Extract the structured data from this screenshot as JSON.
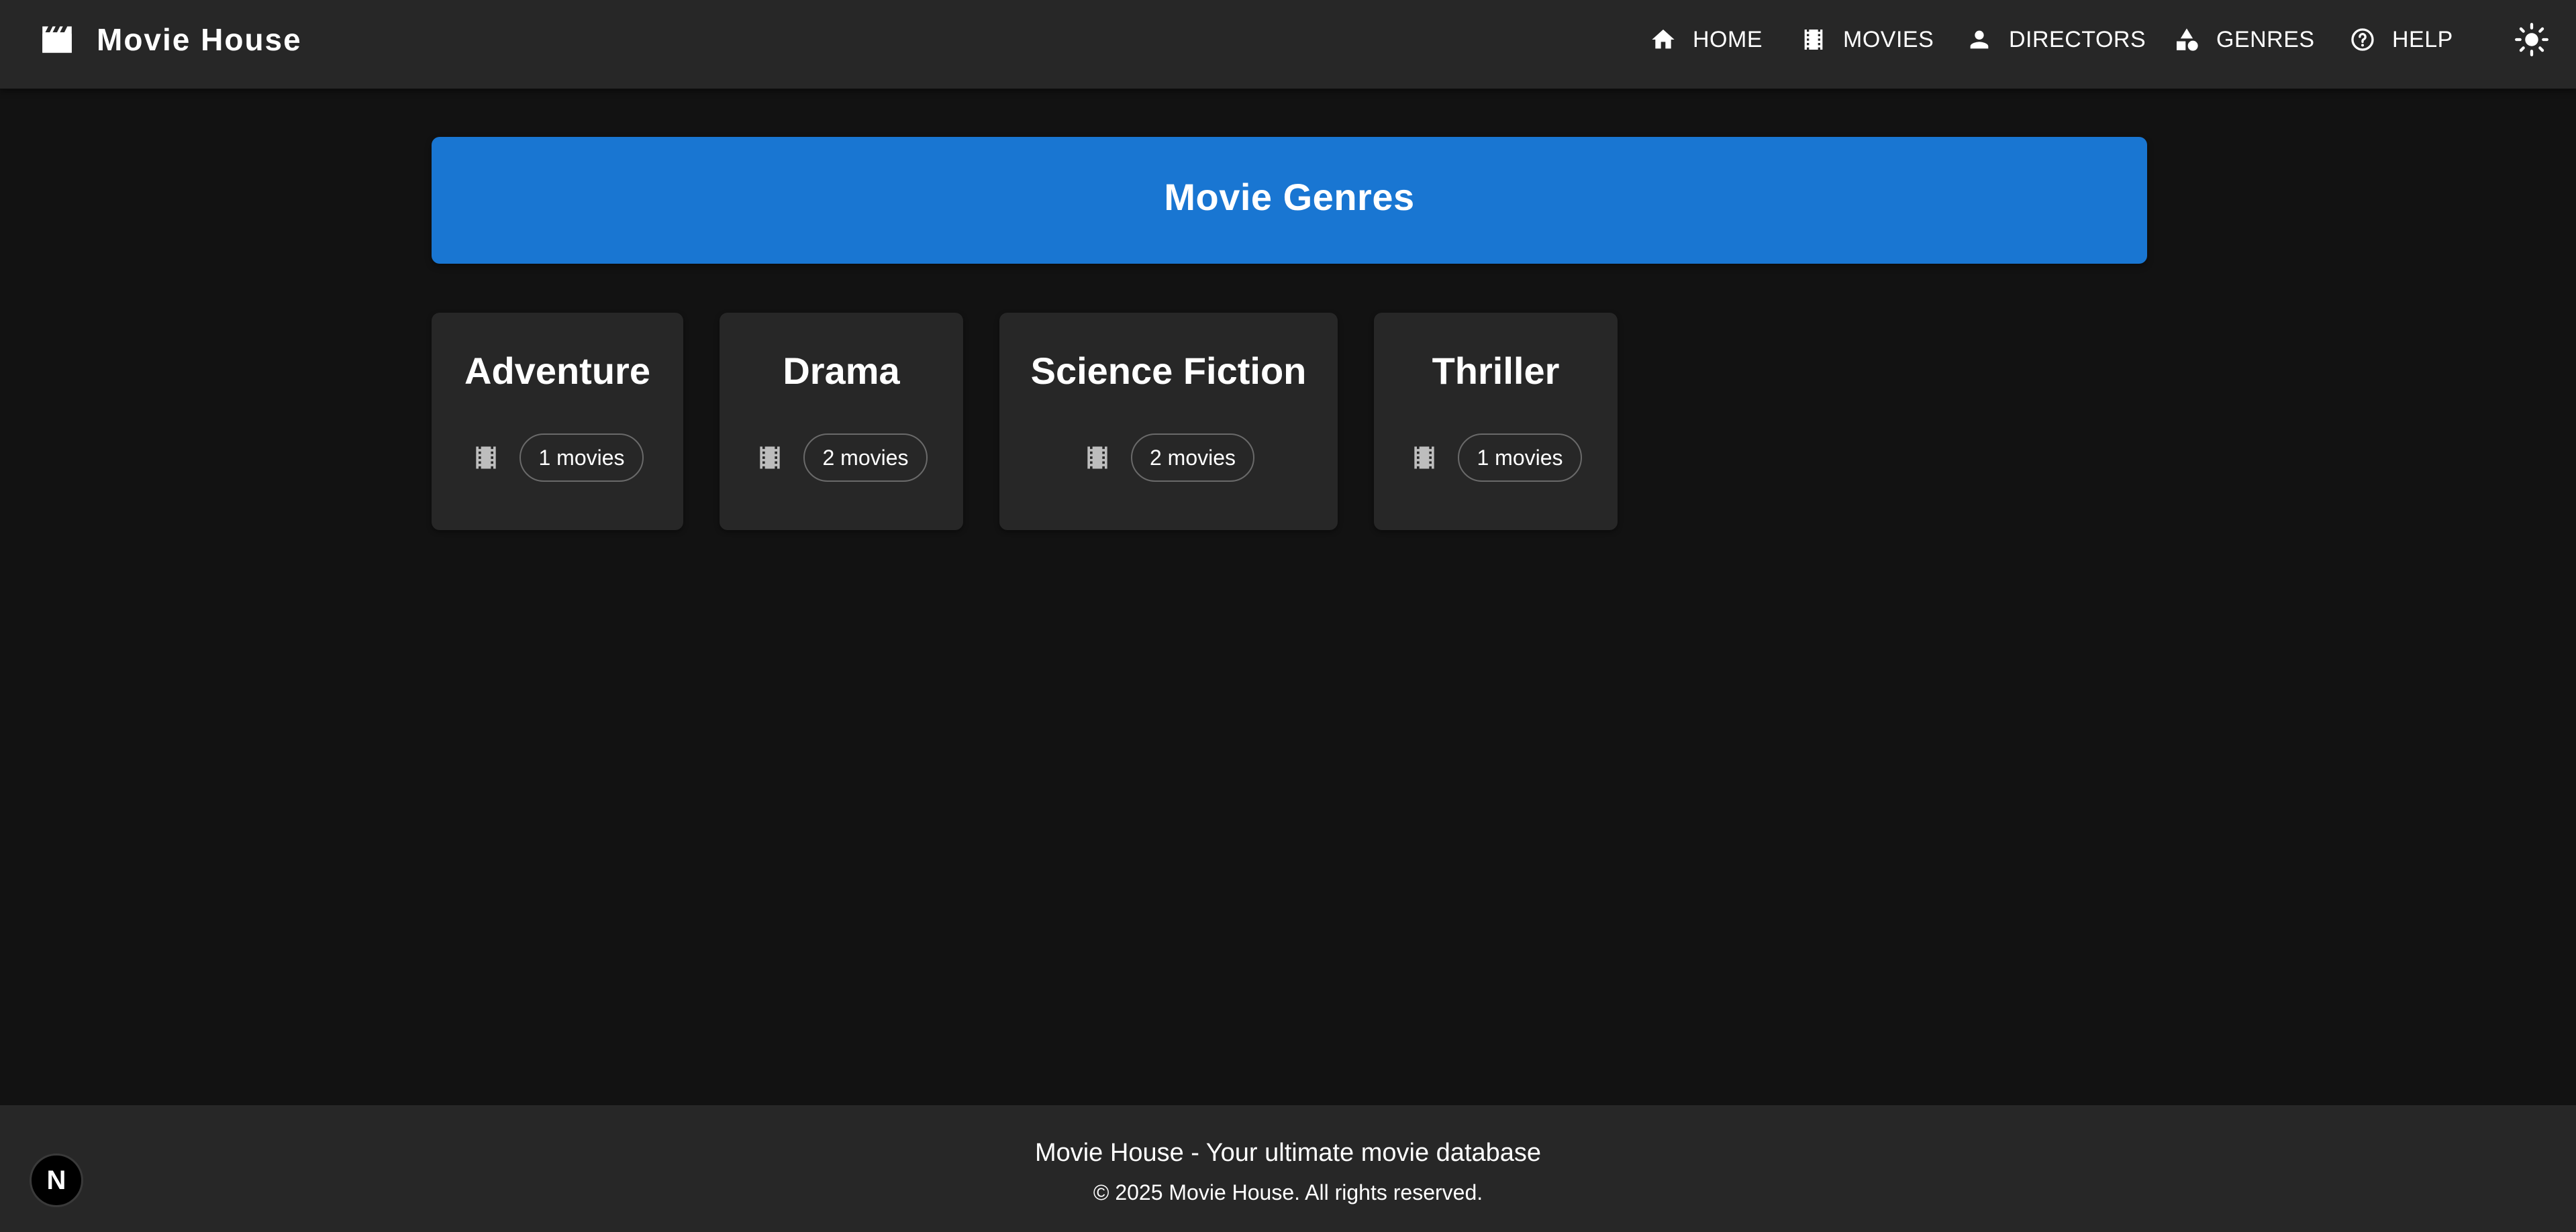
{
  "header": {
    "brand_title": "Movie House",
    "nav": [
      {
        "label": "HOME",
        "icon": "home-icon"
      },
      {
        "label": "MOVIES",
        "icon": "movies-icon"
      },
      {
        "label": "DIRECTORS",
        "icon": "person-icon"
      },
      {
        "label": "GENRES",
        "icon": "category-icon"
      },
      {
        "label": "HELP",
        "icon": "help-icon"
      }
    ],
    "theme_toggle_icon": "sun-icon"
  },
  "main": {
    "page_title": "Movie Genres",
    "genres": [
      {
        "name": "Adventure",
        "count_label": "1 movies"
      },
      {
        "name": "Drama",
        "count_label": "2 movies"
      },
      {
        "name": "Science Fiction",
        "count_label": "2 movies"
      },
      {
        "name": "Thriller",
        "count_label": "1 movies"
      }
    ]
  },
  "footer": {
    "tagline": "Movie House - Your ultimate movie database",
    "copyright": "© 2025 Movie House. All rights reserved."
  },
  "dev_badge": {
    "label": "N"
  },
  "colors": {
    "background": "#121212",
    "surface": "#272727",
    "primary": "#1976d2",
    "text": "#ffffff",
    "chip_border": "#6a6a6a"
  }
}
